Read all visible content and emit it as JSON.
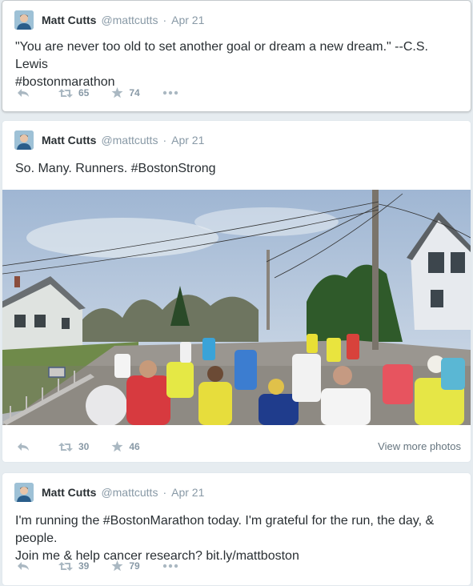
{
  "tweets": [
    {
      "fullname": "Matt Cutts",
      "username": "@mattcutts",
      "separator": "·",
      "date": "Apr 21",
      "text_lines": [
        "\"You are never too old to set another goal or dream a new dream.\" --C.S. Lewis",
        "#bostonmarathon"
      ],
      "retweets": "65",
      "favorites": "74"
    },
    {
      "fullname": "Matt Cutts",
      "username": "@mattcutts",
      "separator": "·",
      "date": "Apr 21",
      "text_lines": [
        "So. Many. Runners. #BostonStrong"
      ],
      "retweets": "30",
      "favorites": "46",
      "view_more": "View more photos"
    },
    {
      "fullname": "Matt Cutts",
      "username": "@mattcutts",
      "separator": "·",
      "date": "Apr 21",
      "text_lines": [
        "I'm running the #BostonMarathon today. I'm grateful for the run, the day, & people.",
        "Join me & help cancer research? bit.ly/mattboston"
      ],
      "retweets": "39",
      "favorites": "79"
    }
  ],
  "icons": {
    "reply": "reply-icon",
    "retweet": "retweet-icon",
    "favorite": "star-icon",
    "more": "more-icon"
  },
  "colors": {
    "background": "#e6ecf0",
    "card": "#ffffff",
    "muted": "#8899a6",
    "icon": "#aab8c2",
    "text": "#292f33"
  }
}
